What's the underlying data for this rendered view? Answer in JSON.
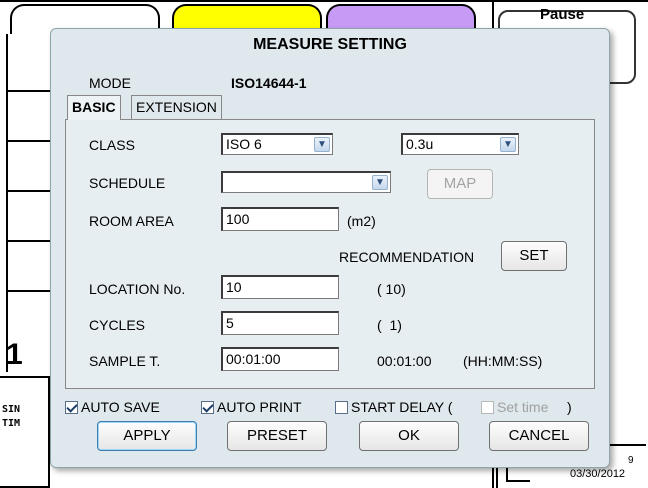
{
  "background": {
    "big_number": "1",
    "small_labels": [
      "SIN",
      "TIM"
    ],
    "pause_label": "Pause",
    "footer_date": "03/30/2012",
    "footer_num": "9"
  },
  "dialog": {
    "title": "MEASURE SETTING",
    "mode_label": "MODE",
    "mode_value": "ISO14644-1",
    "tabs": [
      "BASIC",
      "EXTENSION"
    ],
    "class_label": "CLASS",
    "class_value": "ISO 6",
    "particle_value": "0.3u",
    "schedule_label": "SCHEDULE",
    "schedule_value": "",
    "map_button": "MAP",
    "room_area_label": "ROOM AREA",
    "room_area_value": "100",
    "room_area_unit": "(m2)",
    "recommendation_label": "RECOMMENDATION",
    "set_button": "SET",
    "location_label": "LOCATION No.",
    "location_value": "10",
    "location_rec": "( 10)",
    "cycles_label": "CYCLES",
    "cycles_value": "5",
    "cycles_rec": "(  1)",
    "sample_label": "SAMPLE T.",
    "sample_value": "00:01:00",
    "sample_rec": "00:01:00",
    "sample_format": "(HH:MM:SS)",
    "auto_save_label": "AUTO SAVE",
    "auto_save_checked": true,
    "auto_print_label": "AUTO PRINT",
    "auto_print_checked": true,
    "start_delay_label": "START DELAY (",
    "start_delay_checked": false,
    "set_time_label": "Set time",
    "set_time_checked": false,
    "close_paren": ")",
    "apply_button": "APPLY",
    "preset_button": "PRESET",
    "ok_button": "OK",
    "cancel_button": "CANCEL"
  },
  "icons": {
    "dropdown": "chevron-down-icon",
    "checkbox": "checkmark-icon"
  }
}
